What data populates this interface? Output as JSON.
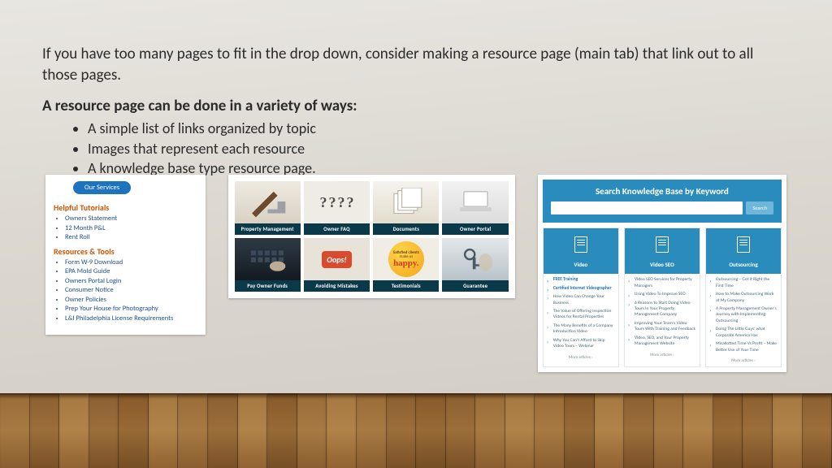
{
  "intro": "If you have too many pages to fit in the drop down, consider making a resource page (main tab) that link out to all those pages.",
  "subhead": "A resource page can be done in a variety of ways:",
  "ways": [
    "A simple list of links organized by topic",
    "Images that represent each resource",
    "A knowledge base type resource page."
  ],
  "ex1": {
    "pill": "Our Services",
    "group1_title": "Helpful Tutorials",
    "group1_items": [
      "Owners Statement",
      "12 Month P&L",
      "Rent Roll"
    ],
    "group2_title": "Resources & Tools",
    "group2_items": [
      "Form W-9 Download",
      "EPA Mold Guide",
      "Owners Portal Login",
      "Consumer Notice",
      "Owner Policies",
      "Prep Your House for Photography",
      "L&I Philadelphia License Requirements"
    ]
  },
  "ex2": {
    "tiles": [
      "Property Management",
      "Owner FAQ",
      "Documents",
      "Owner Portal",
      "Pay Owner Funds",
      "Avoiding Mistakes",
      "Testimonials",
      "Guarantee"
    ],
    "oops": "Oops!",
    "satisfied_top": "Satisfied clients",
    "satisfied_mid": "make us",
    "satisfied_bot": "happy."
  },
  "ex3": {
    "hero_title": "Search Knowledge Base by Keyword",
    "search_placeholder": "",
    "search_btn": "Search",
    "cols": [
      {
        "title": "Video",
        "items": [
          "FREE Training",
          "Certified Internet Videographer",
          "How Video Can Change Your Business",
          "The Value of Offering Inspection Videos for Rental Properties",
          "The Many Benefits of a Company Introduction Video",
          "Why You Can't Afford to Skip Video Tours – Webinar"
        ]
      },
      {
        "title": "Video SEO",
        "items": [
          "Video SEO Services for Property Managers",
          "Using Video To Improve SEO",
          "6 Reasons to Start Doing Video Tours In Your Property Management Company",
          "Improving Your Team's Video Tours With Training and Feedback",
          "Video, SEO, and Your Property Management Website"
        ]
      },
      {
        "title": "Outsourcing",
        "items": [
          "Outsourcing – Get it Right the First Time",
          "How to Make Outsourcing Work at My Company",
          "A Property Management Owner's Journey with Implementing Outsourcing",
          "Doing The Little Guys' what Corporate America Has",
          "Misallotted Time Vs Profit – Make Better Use of Your Time"
        ]
      }
    ],
    "more": "More articles ›"
  }
}
